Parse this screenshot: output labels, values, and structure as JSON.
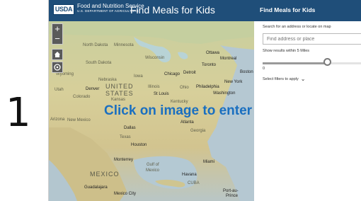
{
  "slide": {
    "number": "1"
  },
  "header": {
    "logo_text": "USDA",
    "agency_name": "Food and Nutrition Service",
    "agency_sub": "U.S. DEPARTMENT OF AGRICULTURE",
    "app_title": "Find Meals for Kids"
  },
  "map": {
    "overlay_text": "Click on image to enter",
    "controls": {
      "zoom_in": "+",
      "zoom_out": "−"
    },
    "labels": [
      {
        "text": "North Dakota",
        "kind": "region"
      },
      {
        "text": "Minnesota",
        "kind": "region"
      },
      {
        "text": "South Dakota",
        "kind": "region"
      },
      {
        "text": "Wisconsin",
        "kind": "region"
      },
      {
        "text": "Wyoming",
        "kind": "region"
      },
      {
        "text": "Nebraska",
        "kind": "region"
      },
      {
        "text": "Iowa",
        "kind": "region"
      },
      {
        "text": "Utah",
        "kind": "region"
      },
      {
        "text": "Colorado",
        "kind": "region"
      },
      {
        "text": "UNITED",
        "kind": "country"
      },
      {
        "text": "STATES",
        "kind": "country"
      },
      {
        "text": "Kansas",
        "kind": "region"
      },
      {
        "text": "Illinois",
        "kind": "region"
      },
      {
        "text": "Ohio",
        "kind": "region"
      },
      {
        "text": "Kentucky",
        "kind": "region"
      },
      {
        "text": "Arizona",
        "kind": "region"
      },
      {
        "text": "New Mexico",
        "kind": "region"
      },
      {
        "text": "Texas",
        "kind": "region"
      },
      {
        "text": "Georgia",
        "kind": "region"
      },
      {
        "text": "MEXICO",
        "kind": "country"
      },
      {
        "text": "Gulf of",
        "kind": "water"
      },
      {
        "text": "Mexico",
        "kind": "water"
      },
      {
        "text": "CUBA",
        "kind": "country"
      },
      {
        "text": "Ottawa",
        "kind": "city"
      },
      {
        "text": "Montreal",
        "kind": "city"
      },
      {
        "text": "Toronto",
        "kind": "city"
      },
      {
        "text": "Boston",
        "kind": "city"
      },
      {
        "text": "Detroit",
        "kind": "city"
      },
      {
        "text": "Chicago",
        "kind": "city"
      },
      {
        "text": "New York",
        "kind": "city"
      },
      {
        "text": "Philadelphia",
        "kind": "city"
      },
      {
        "text": "Washington",
        "kind": "city"
      },
      {
        "text": "Denver",
        "kind": "city"
      },
      {
        "text": "St Louis",
        "kind": "city"
      },
      {
        "text": "Atlanta",
        "kind": "city"
      },
      {
        "text": "Dallas",
        "kind": "city"
      },
      {
        "text": "Houston",
        "kind": "city"
      },
      {
        "text": "Monterrey",
        "kind": "city"
      },
      {
        "text": "Miami",
        "kind": "city"
      },
      {
        "text": "Havana",
        "kind": "city"
      },
      {
        "text": "Guadalajara",
        "kind": "city"
      },
      {
        "text": "Mexico City",
        "kind": "city"
      },
      {
        "text": "Port-au-",
        "kind": "city"
      },
      {
        "text": "Prince",
        "kind": "city"
      }
    ]
  },
  "panel": {
    "title": "Find Meals for Kids",
    "search_hint": "Search for an address or locate on map",
    "search_placeholder": "Find address or place",
    "radius_label": "Show results within 5 Miles",
    "slider_min": "0",
    "radius_fraction": 0.65,
    "filters_label": "Select filters to apply"
  },
  "colors": {
    "header_bg": "#1f4e79",
    "overlay_text": "#1a6fc0"
  }
}
